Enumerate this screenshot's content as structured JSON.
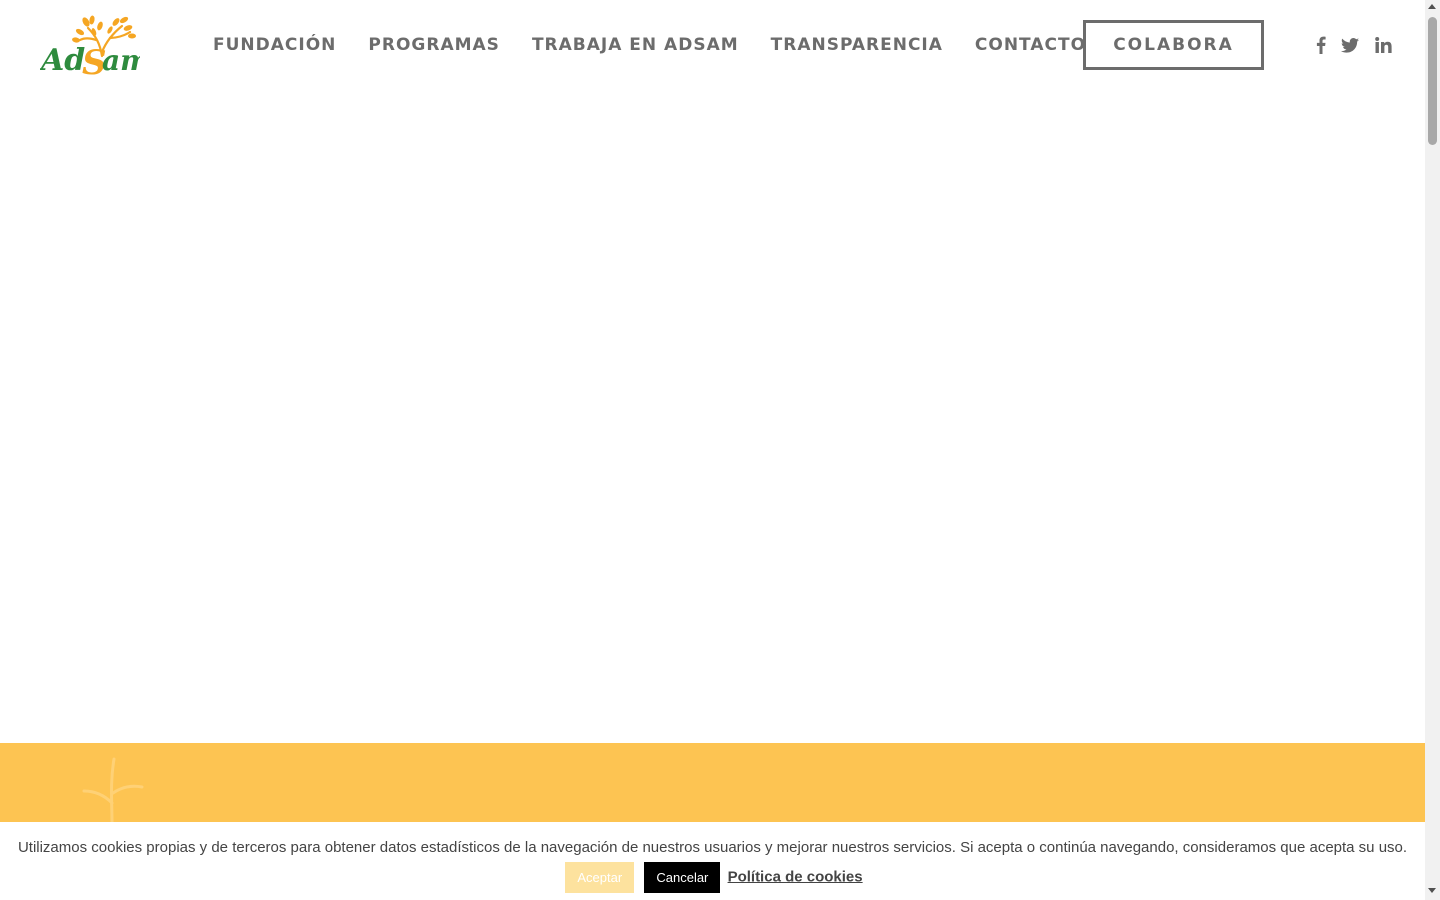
{
  "header": {
    "logo_text": "AdSam",
    "nav": [
      {
        "label": "FUNDACIÓN"
      },
      {
        "label": "PROGRAMAS"
      },
      {
        "label": "TRABAJA EN ADSAM"
      },
      {
        "label": "TRANSPARENCIA"
      },
      {
        "label": "CONTACTO"
      }
    ],
    "cta_label": "COLABORA",
    "social": [
      "facebook-icon",
      "twitter-icon",
      "linkedin-icon"
    ]
  },
  "cookie_bar": {
    "message": "Utilizamos cookies propias y de terceros para obtener datos estadísticos de la navegación de nuestros usuarios y mejorar nuestros servicios. Si acepta o continúa navegando, consideramos que acepta su uso.",
    "accept_label": "Aceptar",
    "cancel_label": "Cancelar",
    "policy_link": "Política de cookies"
  },
  "colors": {
    "nav_text": "#6c6c6c",
    "band": "#fdc452",
    "logo_green": "#2e8b3e",
    "logo_orange": "#f5a623"
  }
}
